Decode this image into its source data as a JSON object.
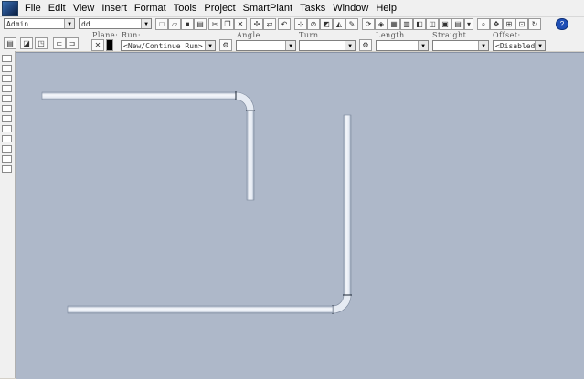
{
  "menubar": {
    "items": [
      "File",
      "Edit",
      "View",
      "Insert",
      "Format",
      "Tools",
      "Project",
      "SmartPlant",
      "Tasks",
      "Window",
      "Help"
    ]
  },
  "toolbar": {
    "permission_group": "Admin",
    "system_value": "dd",
    "plane_label": "Plane:",
    "run_label": "Run:",
    "run_value": "<New/Continue Run>",
    "angle_label": "Angle",
    "turn_label": "Turn",
    "length_label": "Length",
    "straight_label": "Straight",
    "offset_label": "Offset:",
    "offset_value": "<Disabled>"
  },
  "colors": {
    "canvas_bg": "#aeb8c9",
    "pipe_fill": "#eef2f8",
    "pipe_edge": "#6b7a90",
    "joint": "#1a2433"
  }
}
